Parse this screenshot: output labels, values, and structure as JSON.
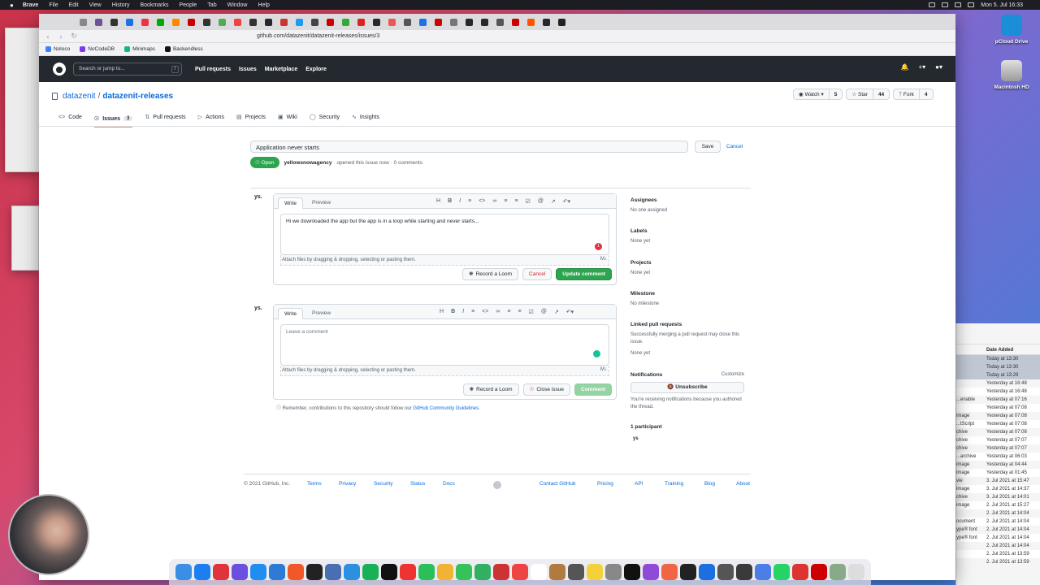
{
  "menubar": {
    "app": "Brave",
    "items": [
      "File",
      "Edit",
      "View",
      "History",
      "Bookmarks",
      "People",
      "Tab",
      "Window",
      "Help"
    ],
    "datetime": "Mon 5. Jul 16:33"
  },
  "desktop": {
    "icons": [
      {
        "label": "pCloud Drive"
      },
      {
        "label": "Macintosh HD"
      }
    ]
  },
  "browser": {
    "url": "github.com/datazenit/datazenit-releases/issues/3",
    "bookmarks": [
      "Noloco",
      "NoCodeDB",
      "Minimaps",
      "Backendless"
    ]
  },
  "github": {
    "search_placeholder": "Search or jump to...",
    "search_key": "/",
    "nav": [
      "Pull requests",
      "Issues",
      "Marketplace",
      "Explore"
    ],
    "owner": "datazenit",
    "repo": "datazenit-releases",
    "watch": {
      "label": "Watch",
      "count": "5"
    },
    "star": {
      "label": "Star",
      "count": "44"
    },
    "fork": {
      "label": "Fork",
      "count": "4"
    },
    "tabs": [
      {
        "label": "Code"
      },
      {
        "label": "Issues",
        "count": "3"
      },
      {
        "label": "Pull requests"
      },
      {
        "label": "Actions"
      },
      {
        "label": "Projects"
      },
      {
        "label": "Wiki"
      },
      {
        "label": "Security"
      },
      {
        "label": "Insights"
      }
    ]
  },
  "issue": {
    "title": "Application never starts",
    "save": "Save",
    "cancel": "Cancel",
    "state": "Open",
    "author": "yellowsnowagency",
    "meta": "opened this issue now · 0 comments"
  },
  "comment1": {
    "avatar": "ys.",
    "write": "Write",
    "preview": "Preview",
    "text": "Hi we downloaded the app but the app is in a loop while starting and never starts...",
    "notif_count": "1",
    "attach": "Attach files by dragging & dropping, selecting or pasting them.",
    "record": "Record a Loom",
    "cancel": "Cancel",
    "update": "Update comment"
  },
  "comment2": {
    "avatar": "ys.",
    "write": "Write",
    "preview": "Preview",
    "placeholder": "Leave a comment",
    "attach": "Attach files by dragging & dropping, selecting or pasting them.",
    "record": "Record a Loom",
    "close": "Close issue",
    "comment": "Comment"
  },
  "remember": {
    "text": "Remember, contributions to this repository should follow our ",
    "link": "GitHub Community Guidelines",
    "end": "."
  },
  "sidebar": {
    "assignees": {
      "h": "Assignees",
      "v": "No one assigned"
    },
    "labels": {
      "h": "Labels",
      "v": "None yet"
    },
    "projects": {
      "h": "Projects",
      "v": "None yet"
    },
    "milestone": {
      "h": "Milestone",
      "v": "No milestone"
    },
    "linked": {
      "h": "Linked pull requests",
      "v": "Successfully merging a pull request may close this issue.",
      "v2": "None yet"
    },
    "notifications": {
      "h": "Notifications",
      "customize": "Customize",
      "unsubscribe": "Unsubscribe",
      "v": "You're receiving notifications because you authored the thread."
    },
    "participants": {
      "h": "1 participant",
      "avatar": "ys"
    }
  },
  "footer": {
    "copyright": "© 2021 GitHub, Inc.",
    "links": [
      "Terms",
      "Privacy",
      "Security",
      "Status",
      "Docs",
      "Contact GitHub",
      "Pricing",
      "API",
      "Training",
      "Blog",
      "About"
    ]
  },
  "finder": {
    "column": "Date Added",
    "rows": [
      {
        "name": "",
        "date": "Today at 13:30"
      },
      {
        "name": "",
        "date": "Today at 13:30"
      },
      {
        "name": "",
        "date": "Today at 13:29"
      },
      {
        "name": "",
        "date": "Yesterday at 16:48"
      },
      {
        "name": "",
        "date": "Yesterday at 16:48"
      },
      {
        "name": "...enable",
        "date": "Yesterday at 07:16"
      },
      {
        "name": "",
        "date": "Yesterday at 07:08"
      },
      {
        "name": "image",
        "date": "Yesterday at 07:08"
      },
      {
        "name": "...tScript",
        "date": "Yesterday at 07:08"
      },
      {
        "name": "chive",
        "date": "Yesterday at 07:08"
      },
      {
        "name": "chive",
        "date": "Yesterday at 07:07"
      },
      {
        "name": "chive",
        "date": "Yesterday at 07:07"
      },
      {
        "name": "...archive",
        "date": "Yesterday at 06:03"
      },
      {
        "name": "image",
        "date": "Yesterday at 04:44"
      },
      {
        "name": "image",
        "date": "Yesterday at 01:45"
      },
      {
        "name": "vie",
        "date": "3. Jul 2021 at 15:47"
      },
      {
        "name": "image",
        "date": "3. Jul 2021 at 14:37"
      },
      {
        "name": "chive",
        "date": "3. Jul 2021 at 14:01"
      },
      {
        "name": "image",
        "date": "2. Jul 2021 at 15:27"
      },
      {
        "name": "",
        "date": "2. Jul 2021 at 14:04"
      },
      {
        "name": "ocument",
        "date": "2. Jul 2021 at 14:04"
      },
      {
        "name": "ype® font",
        "date": "2. Jul 2021 at 14:04"
      },
      {
        "name": "ype® font",
        "date": "2. Jul 2021 at 14:04"
      },
      {
        "name": "",
        "date": "2. Jul 2021 at 14:04"
      },
      {
        "name": "",
        "date": "2. Jul 2021 at 13:59"
      },
      {
        "name": "",
        "date": "2. Jul 2021 at 13:59"
      }
    ]
  },
  "colors": {
    "github_dark": "#24292f",
    "link": "#0969da",
    "green": "#2da44e",
    "danger": "#cf222e"
  }
}
